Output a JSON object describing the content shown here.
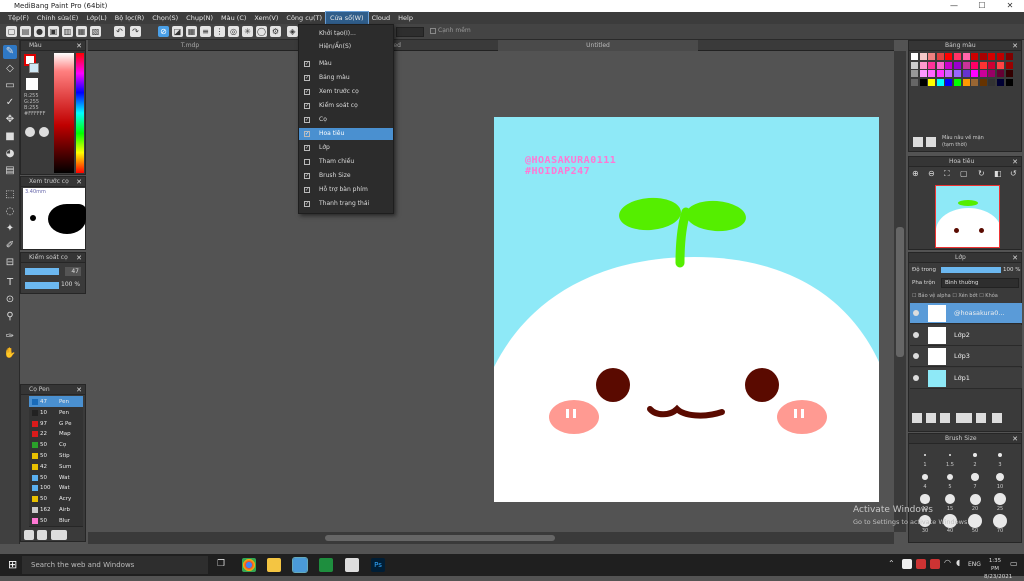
{
  "window": {
    "title": "MediBang Paint Pro (64bit)",
    "minimize": "—",
    "maximize": "☐",
    "close": "✕"
  },
  "menu": [
    "Tệp(F)",
    "Chỉnh sửa(E)",
    "Lớp(L)",
    "Bộ lọc(R)",
    "Chọn(S)",
    "Chụp(N)",
    "Màu (C)",
    "Xem(V)",
    "Công cụ(T)",
    "Cửa sổ(W)",
    "Cloud",
    "Help"
  ],
  "menu_active_index": 9,
  "toolbar": {
    "antialias_label": "Cạnh mềm"
  },
  "tabs": {
    "left": "T.mdp",
    "partial": "lab",
    "partial2": "ted",
    "current": "Untitled"
  },
  "dropdown": {
    "items": [
      {
        "label": "Khởi tạo(I)...",
        "check": ""
      },
      {
        "label": "Hiện/Ẩn(S)",
        "check": ""
      },
      {
        "label": "Màu",
        "check": "✓"
      },
      {
        "label": "Bảng màu",
        "check": "✓"
      },
      {
        "label": "Xem trước cọ",
        "check": "✓"
      },
      {
        "label": "Kiểm soát cọ",
        "check": "✓"
      },
      {
        "label": "Cọ",
        "check": "✓"
      },
      {
        "label": "Hoa tiêu",
        "check": "✓"
      },
      {
        "label": "Lớp",
        "check": "✓"
      },
      {
        "label": "Tham chiếu",
        "check": ""
      },
      {
        "label": "Brush Size",
        "check": "✓"
      },
      {
        "label": "Hỗ trợ bàn phím",
        "check": "✓"
      },
      {
        "label": "Thanh trạng thái",
        "check": "✓"
      }
    ],
    "highlight_index": 7
  },
  "color_panel": {
    "title": "Màu",
    "r": "R:255",
    "g": "G:255",
    "b": "B:255",
    "hex": "#FFFFFF"
  },
  "brush_preview": {
    "title": "Xem trước cọ",
    "size": "3.40mm"
  },
  "brush_control": {
    "title": "Kiểm soát cọ",
    "size": "47",
    "opacity": "100 %"
  },
  "brush_panel": {
    "title": "Cọ Pen",
    "items": [
      {
        "color": "#1a6bb8",
        "num": "47",
        "name": "Pen"
      },
      {
        "color": "#222222",
        "num": "10",
        "name": "Pen"
      },
      {
        "color": "#d81b1b",
        "num": "97",
        "name": "G Pe"
      },
      {
        "color": "#d81b1b",
        "num": "22",
        "name": "Map"
      },
      {
        "color": "#2aa02a",
        "num": "50",
        "name": "Cọ"
      },
      {
        "color": "#e8c000",
        "num": "50",
        "name": "Stip"
      },
      {
        "color": "#e8c000",
        "num": "42",
        "name": "Sum"
      },
      {
        "color": "#5ab0f0",
        "num": "50",
        "name": "Wat"
      },
      {
        "color": "#5ab0f0",
        "num": "100",
        "name": "Wat"
      },
      {
        "color": "#e8c000",
        "num": "50",
        "name": "Acry"
      },
      {
        "color": "#cccccc",
        "num": "162",
        "name": "Airb"
      },
      {
        "color": "#ff78d4",
        "num": "50",
        "name": "Blur"
      }
    ]
  },
  "palette": {
    "title": "Bảng màu",
    "note": "Màu nâu về mặn (tạm thời)",
    "colors": [
      "#ffffff",
      "#f4c8c8",
      "#f08080",
      "#e04040",
      "#ff0000",
      "#ff3366",
      "#ff66aa",
      "#cc0000",
      "#aa0000",
      "#d40000",
      "#c00000",
      "#800000",
      "#cccccc",
      "#ff99cc",
      "#ff3399",
      "#ff66cc",
      "#cc00cc",
      "#9900cc",
      "#cc3399",
      "#ff0066",
      "#ff3333",
      "#cc0033",
      "#ff4444",
      "#990000",
      "#999999",
      "#ff99ff",
      "#ff66ff",
      "#ff33ff",
      "#cc66ff",
      "#9966ff",
      "#6633cc",
      "#ff00ff",
      "#cc0099",
      "#990066",
      "#660033",
      "#330000",
      "#666666",
      "#000000",
      "#ffff00",
      "#00ffff",
      "#0000ff",
      "#00ff00",
      "#ff9900",
      "#996633",
      "#663300",
      "#333333",
      "#000033",
      "#000000"
    ]
  },
  "navigator": {
    "title": "Hoa tiêu"
  },
  "layers": {
    "title": "Lớp",
    "opacity_label": "Độ trong",
    "opacity_value": "100 %",
    "blend_label": "Pha trộn",
    "blend_value": "Bình thường",
    "protect_alpha": "Bảo vệ alpha",
    "clipping": "Xén bớt",
    "lock": "Khóa",
    "items": [
      {
        "name": "@hoasakura0...",
        "selected": true,
        "thumb": "#ffffff"
      },
      {
        "name": "Lớp2",
        "selected": false,
        "thumb": "#ffffff"
      },
      {
        "name": "Lớp3",
        "selected": false,
        "thumb": "#ffffff"
      },
      {
        "name": "Lớp1",
        "selected": false,
        "thumb": "#8ee9f7"
      }
    ]
  },
  "brush_size": {
    "title": "Brush Size",
    "labels": [
      "1",
      "1.5",
      "2",
      "3",
      "4",
      "5",
      "7",
      "10",
      "12",
      "15",
      "20",
      "25",
      "30",
      "40",
      "50",
      "70"
    ]
  },
  "artwork": {
    "watermark_line1": "@HOASAKURA0111",
    "watermark_line2": "#HOIDAP247"
  },
  "activation": {
    "line1": "Activate Windows",
    "line2": "Go to Settings to activate Windows."
  },
  "taskbar": {
    "search": "Search the web and Windows",
    "time": "1:35 PM",
    "date": "8/23/2021",
    "lang": "ENG"
  }
}
